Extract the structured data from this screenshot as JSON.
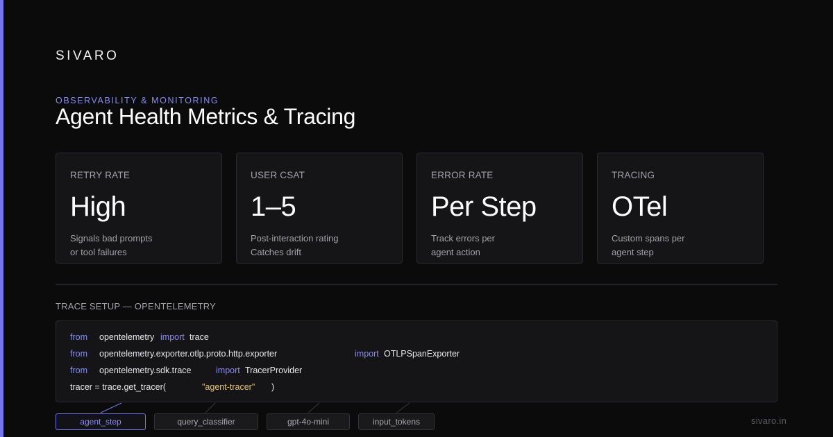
{
  "brand": "SIVARO",
  "eyebrow": "OBSERVABILITY & MONITORING",
  "title": "Agent Health Metrics & Tracing",
  "accent_color": "#7477e8",
  "cards": [
    {
      "label": "RETRY RATE",
      "value": "High",
      "desc": [
        "Signals bad prompts",
        "or tool failures"
      ]
    },
    {
      "label": "USER CSAT",
      "value": "1–5",
      "desc": [
        "Post-interaction rating",
        "Catches drift"
      ]
    },
    {
      "label": "ERROR RATE",
      "value": "Per Step",
      "desc": [
        "Track errors per",
        "agent action"
      ]
    },
    {
      "label": "TRACING",
      "value": "OTel",
      "desc": [
        "Custom spans per",
        "agent step"
      ]
    }
  ],
  "code_section_label": "TRACE SETUP — OPENTELEMETRY",
  "code": {
    "line1": {
      "kw1": "from",
      "mod": "opentelemetry",
      "kw2": "import",
      "name": "trace"
    },
    "line2": {
      "kw1": "from",
      "mod": "opentelemetry.exporter.otlp.proto.http.exporter",
      "kw2": "import",
      "name": "OTLPSpanExporter"
    },
    "line3": {
      "kw1": "from",
      "mod": "opentelemetry.sdk.trace",
      "kw2": "import",
      "name": "TracerProvider"
    },
    "line4": {
      "pre": "tracer = trace.get_tracer(",
      "str": "\"agent-tracer\"",
      "post": ")"
    }
  },
  "tags": [
    {
      "label": "agent_step",
      "active": true
    },
    {
      "label": "query_classifier",
      "active": false
    },
    {
      "label": "gpt-4o-mini",
      "active": false
    },
    {
      "label": "input_tokens",
      "active": false
    }
  ],
  "footer_url": "sivaro.in"
}
